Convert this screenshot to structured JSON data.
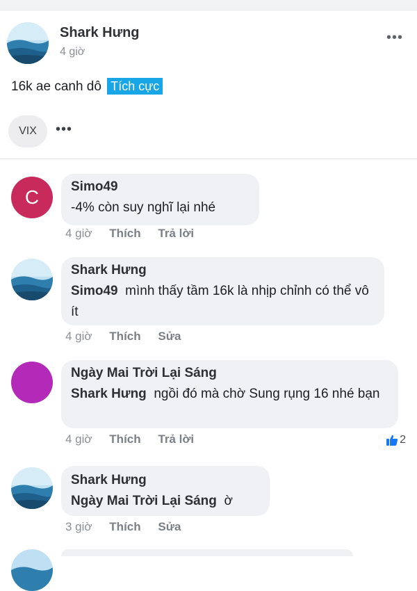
{
  "post": {
    "author": "Shark Hưng",
    "time": "4 giờ",
    "text": "16k ae canh dô",
    "sentiment": "Tích cực",
    "ticker": "VIX",
    "more_icon": "more-dots-icon"
  },
  "comments": [
    {
      "avatar_type": "letter",
      "avatar_letter": "C",
      "name": "Simo49",
      "mention": "",
      "text": "-4% còn suy nghĩ lại nhé",
      "time": "4 giờ",
      "like_label": "Thích",
      "action_label": "Trả lời"
    },
    {
      "avatar_type": "image",
      "name": "Shark Hưng",
      "mention": "Simo49",
      "text": "mình thấy tầm 16k là nhịp chỉnh có thể vô ít",
      "time": "4 giờ",
      "like_label": "Thích",
      "action_label": "Sửa"
    },
    {
      "avatar_type": "purple",
      "name": "Ngày Mai Trời Lại Sáng",
      "mention": "Shark Hưng",
      "text": "ngồi đó mà chờ Sung rụng 16 nhé bạn",
      "time": "4 giờ",
      "like_label": "Thích",
      "action_label": "Trả lời",
      "reaction_count": "2",
      "reaction_icon": "thumbs-up-icon"
    },
    {
      "avatar_type": "image",
      "name": "Shark Hưng",
      "mention": "Ngày Mai Trời Lại Sáng",
      "text": "ờ",
      "time": "3 giờ",
      "like_label": "Thích",
      "action_label": "Sửa"
    }
  ],
  "colors": {
    "sentiment_bg": "#18a6e6",
    "bubble_bg": "#f0f1f4",
    "letter_avatar": "#c72a5b",
    "purple_avatar": "#b42ab8",
    "reaction_blue": "#1877f2"
  }
}
